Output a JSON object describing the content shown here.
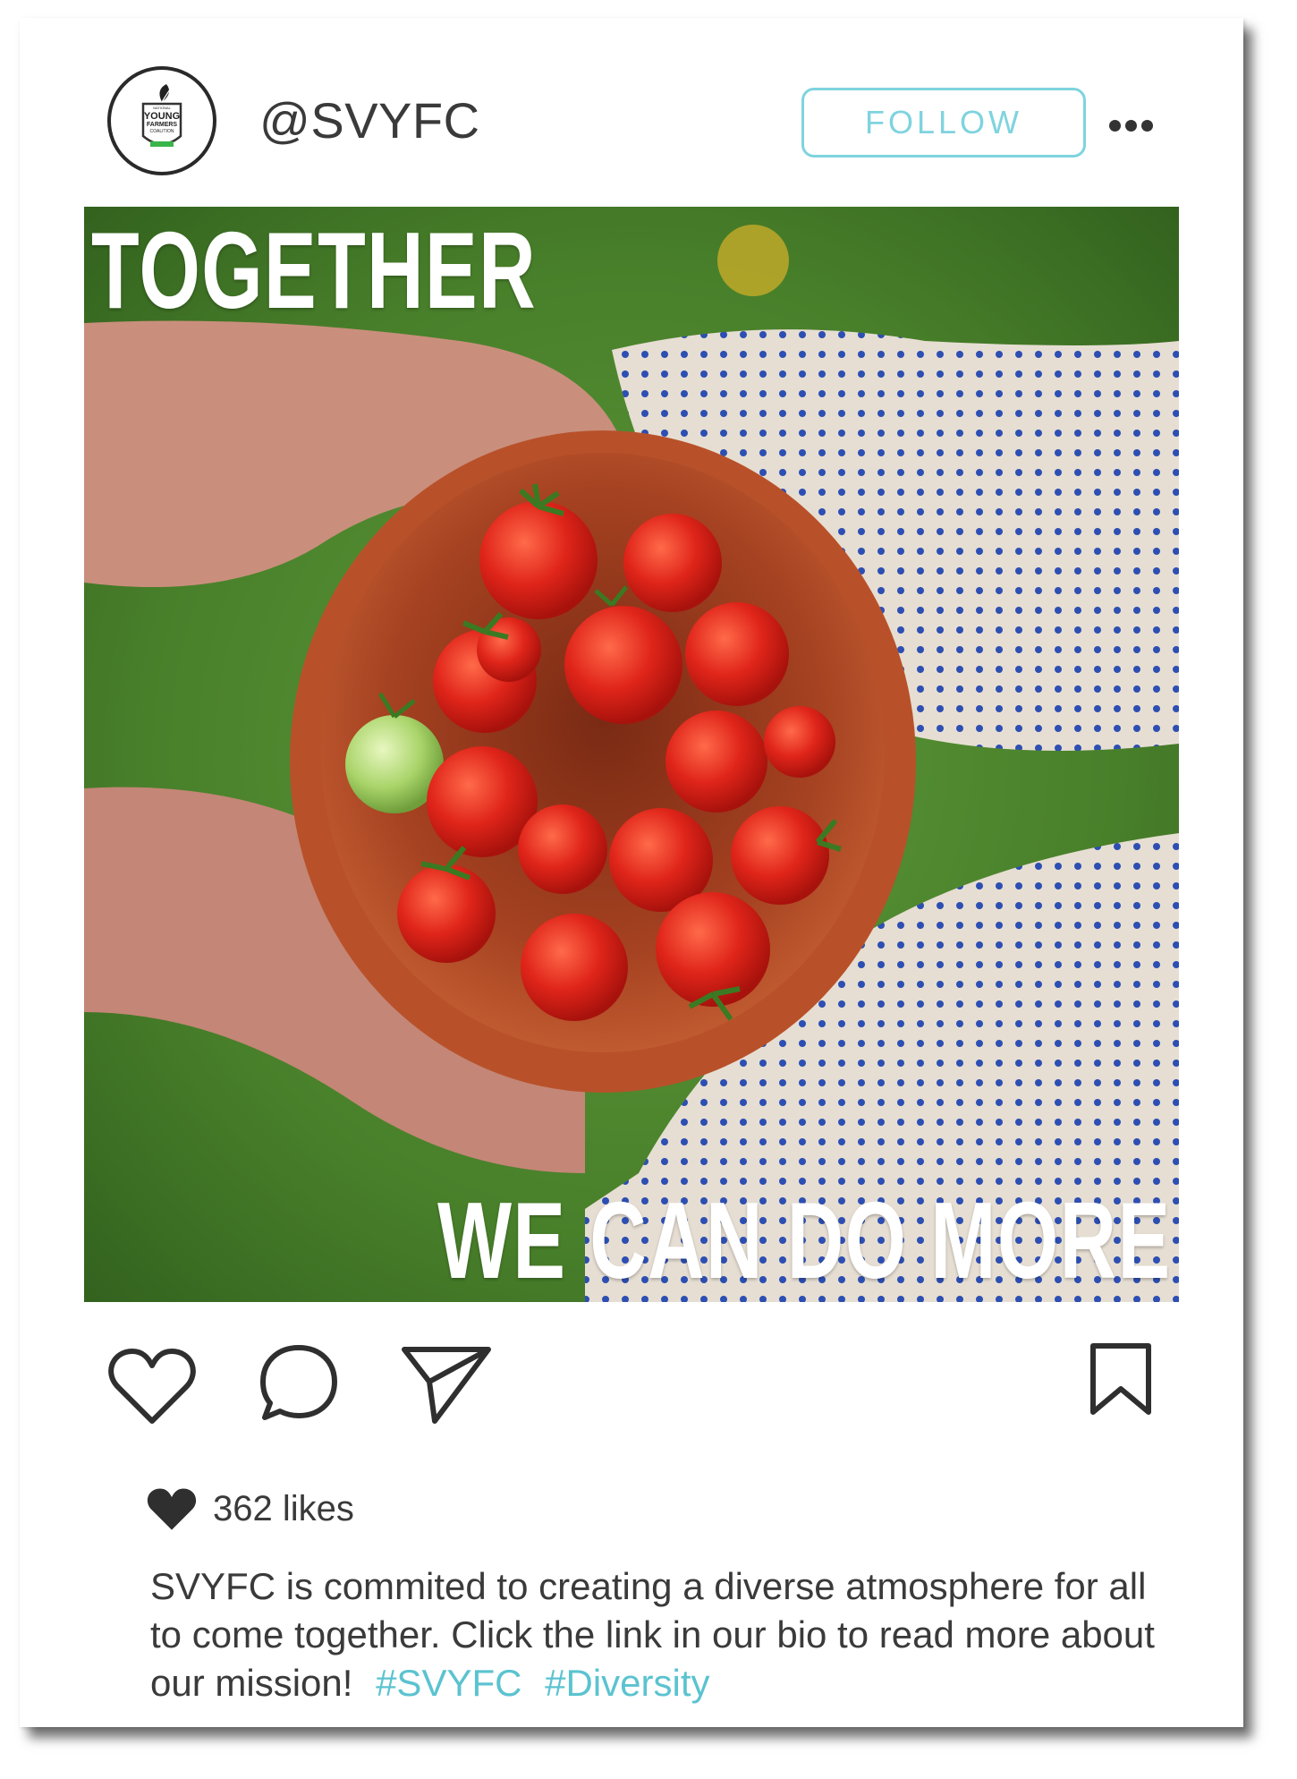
{
  "post": {
    "handle": "@SVYFC",
    "follow_label": "FOLLOW",
    "avatar_logo_lines": [
      "NATIONAL",
      "YOUNG",
      "FARMERS",
      "COALITION"
    ],
    "photo_headline_top": "TOGETHER",
    "photo_headline_bottom": "WE CAN DO MORE",
    "likes_text": "362 likes",
    "caption_text": "SVYFC is commited to creating a diverse atmosphere for all to come together. Click the link in our bio to read more about our mission!",
    "hashtags": [
      "#SVYFC",
      "#Diversity"
    ]
  },
  "colors": {
    "accent": "#7fd3df",
    "hashtag": "#5bc3d0",
    "text": "#3a3a3a"
  },
  "icons": {
    "like": "heart-outline-icon",
    "comment": "speech-bubble-icon",
    "share": "paper-plane-icon",
    "save": "bookmark-icon",
    "more": "ellipsis-icon",
    "likes_indicator": "heart-filled-icon"
  }
}
